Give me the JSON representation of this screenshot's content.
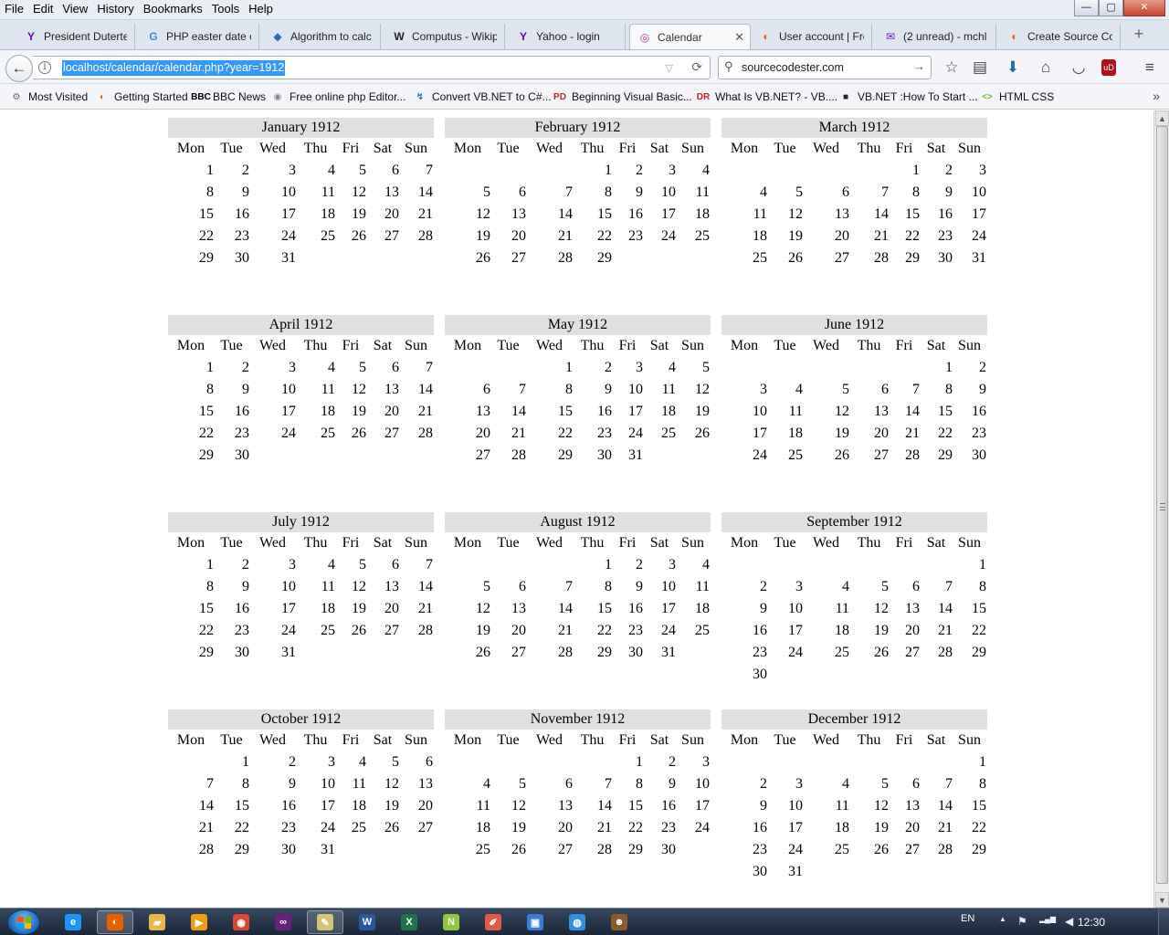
{
  "menubar": {
    "items": [
      "File",
      "Edit",
      "View",
      "History",
      "Bookmarks",
      "Tools",
      "Help"
    ],
    "window_buttons": {
      "minimize": "—",
      "maximize": "▢",
      "close": "✕"
    }
  },
  "tabs": [
    {
      "label": "President Duterte",
      "icon": "yahoo-icon",
      "glyph": "Y",
      "color": "#5f01d1"
    },
    {
      "label": "PHP easter date c",
      "icon": "google-icon",
      "glyph": "G",
      "color": "#4285f4"
    },
    {
      "label": "Algorithm to calc",
      "icon": "stackexchange-icon",
      "glyph": "◆",
      "color": "#2d6ab3"
    },
    {
      "label": "Computus - Wikip",
      "icon": "wikipedia-icon",
      "glyph": "W",
      "color": "#222222"
    },
    {
      "label": "Yahoo - login",
      "icon": "yahoo-icon",
      "glyph": "Y",
      "color": "#5f01d1"
    },
    {
      "label": "Calendar",
      "icon": "localhost-icon",
      "glyph": "◎",
      "color": "#d2308a",
      "active": true,
      "close": "✕"
    },
    {
      "label": "User account | Fre",
      "icon": "firefox-icon",
      "glyph": "◐",
      "color": "#e66000"
    },
    {
      "label": "(2 unread) - mchl",
      "icon": "mail-icon",
      "glyph": "✉",
      "color": "#6b1fb3"
    },
    {
      "label": "Create Source Co",
      "icon": "firefox-icon",
      "glyph": "◐",
      "color": "#e66000"
    }
  ],
  "new_tab": "+",
  "nav": {
    "back": "←",
    "url": "localhost/calendar/calendar.php?year=1912",
    "info": "i",
    "dropdown": "▽",
    "reload": "⟳",
    "search_value": "sourcecodester.com",
    "search_icon": "⚲",
    "search_go": "→",
    "tool_icons": [
      {
        "name": "bookmark-star-icon",
        "glyph": "☆"
      },
      {
        "name": "reading-list-icon",
        "glyph": "▤"
      },
      {
        "name": "download-icon",
        "glyph": "⬇"
      },
      {
        "name": "home-icon",
        "glyph": "⌂"
      },
      {
        "name": "pocket-icon",
        "glyph": "◡"
      },
      {
        "name": "ublock-icon",
        "glyph": "uD"
      },
      {
        "name": "hamburger-menu-icon",
        "glyph": "≡"
      }
    ]
  },
  "bookmarks": [
    {
      "label": "Most Visited",
      "icon": "gear-icon",
      "glyph": "⚙",
      "color": "#666"
    },
    {
      "label": "Getting Started",
      "icon": "firefox-icon",
      "glyph": "◐",
      "color": "#e66000"
    },
    {
      "label": "BBC News",
      "icon": "bbc-icon",
      "glyph": "BBC",
      "color": "#000"
    },
    {
      "label": "Free online php Editor...",
      "icon": "globe-icon",
      "glyph": "◉",
      "color": "#888"
    },
    {
      "label": "Convert VB.NET to C#...",
      "icon": "convert-icon",
      "glyph": "↯",
      "color": "#1f6fb5"
    },
    {
      "label": "Beginning Visual Basic...",
      "icon": "pd-icon",
      "glyph": "PD",
      "color": "#c0282d"
    },
    {
      "label": "What Is VB.NET? - VB....",
      "icon": "dr-icon",
      "glyph": "DR",
      "color": "#c0282d"
    },
    {
      "label": "VB.NET :How To Start ...",
      "icon": "video-icon",
      "glyph": "■",
      "color": "#222"
    },
    {
      "label": "HTML CSS",
      "icon": "html-icon",
      "glyph": "<>",
      "color": "#6fbf2b"
    }
  ],
  "bookmarks_more": "»",
  "calendar": {
    "weekdays": [
      "Mon",
      "Tue",
      "Wed",
      "Thu",
      "Fri",
      "Sat",
      "Sun"
    ],
    "months": [
      {
        "title": "January 1912",
        "weeks": [
          [
            "1",
            "2",
            "3",
            "4",
            "5",
            "6",
            "7"
          ],
          [
            "8",
            "9",
            "10",
            "11",
            "12",
            "13",
            "14"
          ],
          [
            "15",
            "16",
            "17",
            "18",
            "19",
            "20",
            "21"
          ],
          [
            "22",
            "23",
            "24",
            "25",
            "26",
            "27",
            "28"
          ],
          [
            "29",
            "30",
            "31",
            "",
            "",
            "",
            ""
          ]
        ]
      },
      {
        "title": "February 1912",
        "weeks": [
          [
            "",
            "",
            "",
            "1",
            "2",
            "3",
            "4"
          ],
          [
            "5",
            "6",
            "7",
            "8",
            "9",
            "10",
            "11"
          ],
          [
            "12",
            "13",
            "14",
            "15",
            "16",
            "17",
            "18"
          ],
          [
            "19",
            "20",
            "21",
            "22",
            "23",
            "24",
            "25"
          ],
          [
            "26",
            "27",
            "28",
            "29",
            "",
            "",
            ""
          ]
        ]
      },
      {
        "title": "March 1912",
        "weeks": [
          [
            "",
            "",
            "",
            "",
            "1",
            "2",
            "3"
          ],
          [
            "4",
            "5",
            "6",
            "7",
            "8",
            "9",
            "10"
          ],
          [
            "11",
            "12",
            "13",
            "14",
            "15",
            "16",
            "17"
          ],
          [
            "18",
            "19",
            "20",
            "21",
            "22",
            "23",
            "24"
          ],
          [
            "25",
            "26",
            "27",
            "28",
            "29",
            "30",
            "31"
          ]
        ]
      },
      {
        "title": "April 1912",
        "weeks": [
          [
            "1",
            "2",
            "3",
            "4",
            "5",
            "6",
            "7"
          ],
          [
            "8",
            "9",
            "10",
            "11",
            "12",
            "13",
            "14"
          ],
          [
            "15",
            "16",
            "17",
            "18",
            "19",
            "20",
            "21"
          ],
          [
            "22",
            "23",
            "24",
            "25",
            "26",
            "27",
            "28"
          ],
          [
            "29",
            "30",
            "",
            "",
            "",
            "",
            ""
          ]
        ]
      },
      {
        "title": "May 1912",
        "weeks": [
          [
            "",
            "",
            "1",
            "2",
            "3",
            "4",
            "5"
          ],
          [
            "6",
            "7",
            "8",
            "9",
            "10",
            "11",
            "12"
          ],
          [
            "13",
            "14",
            "15",
            "16",
            "17",
            "18",
            "19"
          ],
          [
            "20",
            "21",
            "22",
            "23",
            "24",
            "25",
            "26"
          ],
          [
            "27",
            "28",
            "29",
            "30",
            "31",
            "",
            ""
          ]
        ]
      },
      {
        "title": "June 1912",
        "weeks": [
          [
            "",
            "",
            "",
            "",
            "",
            "1",
            "2"
          ],
          [
            "3",
            "4",
            "5",
            "6",
            "7",
            "8",
            "9"
          ],
          [
            "10",
            "11",
            "12",
            "13",
            "14",
            "15",
            "16"
          ],
          [
            "17",
            "18",
            "19",
            "20",
            "21",
            "22",
            "23"
          ],
          [
            "24",
            "25",
            "26",
            "27",
            "28",
            "29",
            "30"
          ]
        ]
      },
      {
        "title": "July 1912",
        "weeks": [
          [
            "1",
            "2",
            "3",
            "4",
            "5",
            "6",
            "7"
          ],
          [
            "8",
            "9",
            "10",
            "11",
            "12",
            "13",
            "14"
          ],
          [
            "15",
            "16",
            "17",
            "18",
            "19",
            "20",
            "21"
          ],
          [
            "22",
            "23",
            "24",
            "25",
            "26",
            "27",
            "28"
          ],
          [
            "29",
            "30",
            "31",
            "",
            "",
            "",
            ""
          ]
        ]
      },
      {
        "title": "August 1912",
        "weeks": [
          [
            "",
            "",
            "",
            "1",
            "2",
            "3",
            "4"
          ],
          [
            "5",
            "6",
            "7",
            "8",
            "9",
            "10",
            "11"
          ],
          [
            "12",
            "13",
            "14",
            "15",
            "16",
            "17",
            "18"
          ],
          [
            "19",
            "20",
            "21",
            "22",
            "23",
            "24",
            "25"
          ],
          [
            "26",
            "27",
            "28",
            "29",
            "30",
            "31",
            ""
          ]
        ]
      },
      {
        "title": "September 1912",
        "weeks": [
          [
            "",
            "",
            "",
            "",
            "",
            "",
            "1"
          ],
          [
            "2",
            "3",
            "4",
            "5",
            "6",
            "7",
            "8"
          ],
          [
            "9",
            "10",
            "11",
            "12",
            "13",
            "14",
            "15"
          ],
          [
            "16",
            "17",
            "18",
            "19",
            "20",
            "21",
            "22"
          ],
          [
            "23",
            "24",
            "25",
            "26",
            "27",
            "28",
            "29"
          ],
          [
            "30",
            "",
            "",
            "",
            "",
            "",
            ""
          ]
        ]
      },
      {
        "title": "October 1912",
        "weeks": [
          [
            "",
            "1",
            "2",
            "3",
            "4",
            "5",
            "6"
          ],
          [
            "7",
            "8",
            "9",
            "10",
            "11",
            "12",
            "13"
          ],
          [
            "14",
            "15",
            "16",
            "17",
            "18",
            "19",
            "20"
          ],
          [
            "21",
            "22",
            "23",
            "24",
            "25",
            "26",
            "27"
          ],
          [
            "28",
            "29",
            "30",
            "31",
            "",
            "",
            ""
          ]
        ]
      },
      {
        "title": "November 1912",
        "weeks": [
          [
            "",
            "",
            "",
            "",
            "1",
            "2",
            "3"
          ],
          [
            "4",
            "5",
            "6",
            "7",
            "8",
            "9",
            "10"
          ],
          [
            "11",
            "12",
            "13",
            "14",
            "15",
            "16",
            "17"
          ],
          [
            "18",
            "19",
            "20",
            "21",
            "22",
            "23",
            "24"
          ],
          [
            "25",
            "26",
            "27",
            "28",
            "29",
            "30",
            ""
          ]
        ]
      },
      {
        "title": "December 1912",
        "weeks": [
          [
            "",
            "",
            "",
            "",
            "",
            "",
            "1"
          ],
          [
            "2",
            "3",
            "4",
            "5",
            "6",
            "7",
            "8"
          ],
          [
            "9",
            "10",
            "11",
            "12",
            "13",
            "14",
            "15"
          ],
          [
            "16",
            "17",
            "18",
            "19",
            "20",
            "21",
            "22"
          ],
          [
            "23",
            "24",
            "25",
            "26",
            "27",
            "28",
            "29"
          ],
          [
            "30",
            "31",
            "",
            "",
            "",
            "",
            ""
          ]
        ]
      }
    ]
  },
  "scrollbar": {
    "up": "▲",
    "down": "▼"
  },
  "taskbar": {
    "apps": [
      {
        "name": "ie-icon",
        "glyph": "e",
        "color": "#1e90ff"
      },
      {
        "name": "firefox-icon",
        "glyph": "◐",
        "color": "#e66000",
        "active": true
      },
      {
        "name": "explorer-folder-icon",
        "glyph": "▰",
        "color": "#e8b84a"
      },
      {
        "name": "media-player-icon",
        "glyph": "▶",
        "color": "#f39c12"
      },
      {
        "name": "chrome-icon",
        "glyph": "◉",
        "color": "#db4437"
      },
      {
        "name": "visual-studio-icon",
        "glyph": "∞",
        "color": "#68217a"
      },
      {
        "name": "notepad-icon",
        "glyph": "✎",
        "color": "#d4c47a",
        "active": true
      },
      {
        "name": "word-icon",
        "glyph": "W",
        "color": "#2b579a"
      },
      {
        "name": "excel-icon",
        "glyph": "X",
        "color": "#217346"
      },
      {
        "name": "notepadpp-icon",
        "glyph": "N",
        "color": "#90c53f"
      },
      {
        "name": "paint-icon",
        "glyph": "✐",
        "color": "#e05a4b"
      },
      {
        "name": "network-app-icon",
        "glyph": "▣",
        "color": "#3a7bd5"
      },
      {
        "name": "browser-globe-icon",
        "glyph": "◍",
        "color": "#2f8fe0"
      },
      {
        "name": "owl-app-icon",
        "glyph": "☻",
        "color": "#8a5a2b"
      }
    ],
    "tray": {
      "language": "EN",
      "clock": "12:30",
      "icons": [
        {
          "name": "show-hidden-icons-icon",
          "glyph": "▲"
        },
        {
          "name": "action-center-flag-icon",
          "glyph": "⚑"
        },
        {
          "name": "network-signal-icon",
          "glyph": "▂▄▆"
        },
        {
          "name": "volume-icon",
          "glyph": "◀"
        }
      ]
    }
  }
}
